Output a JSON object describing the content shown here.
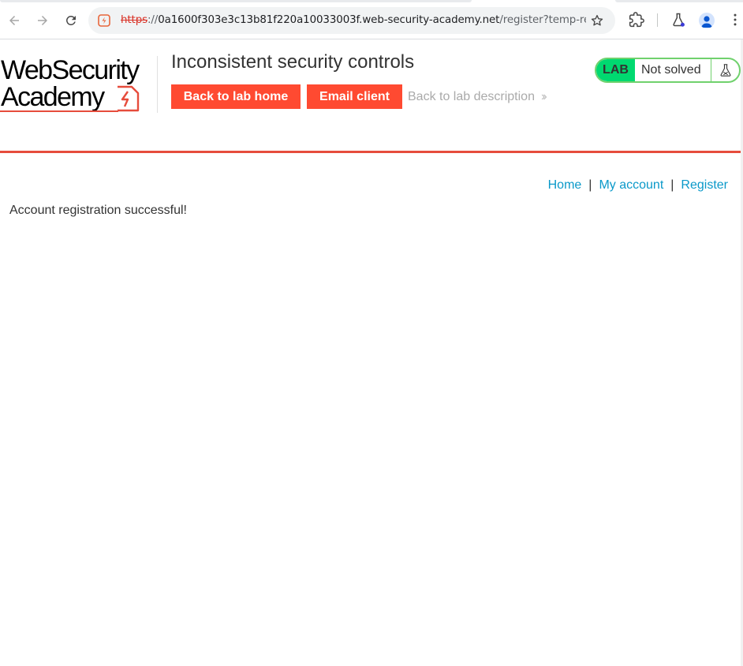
{
  "browser": {
    "url_scheme": "https",
    "url_separator": "://",
    "url_host": "0a1600f303e3c13b81f220a10033003f.web-security-academy.net",
    "url_path": "/register?temp-reg…"
  },
  "header": {
    "logo_line1": "WebSecurity",
    "logo_line2": "Academy",
    "lab_title": "Inconsistent security controls",
    "back_to_lab_home": "Back to lab home",
    "email_client": "Email client",
    "back_to_description": "Back to lab description",
    "lab_badge": "LAB",
    "lab_state": "Not solved"
  },
  "nav": {
    "home": "Home",
    "sep1": "|",
    "my_account": "My account",
    "sep2": "|",
    "register": "Register"
  },
  "main": {
    "message": "Account registration successful!"
  },
  "colors": {
    "accent_red": "#ff4a31",
    "header_rule": "#e64c3c",
    "lab_green": "#00d970",
    "link_blue": "#0a99c9"
  }
}
